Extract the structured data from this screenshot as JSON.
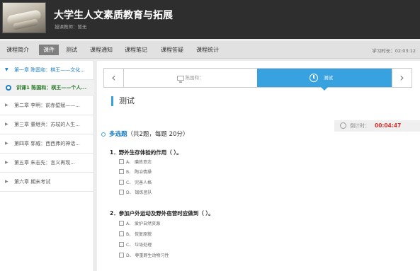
{
  "header": {
    "course_title": "大学生人文素质教育与拓展",
    "teacher_label": "授课教师：暂无"
  },
  "nav": {
    "items": [
      "课程简介",
      "课件",
      "测试",
      "课程通知",
      "课程笔记",
      "课程答疑",
      "课程统计"
    ],
    "active": "课件",
    "study_time": "学习时长：02:03:12"
  },
  "sidebar": {
    "open_chapter": "第一章 陈国和：棋王——文化...",
    "current_lesson": "讲课1 陈国和：棋王——个人...",
    "chapters": [
      "第二章 李明：前赤壁赋——...",
      "第三章 董继兵：苏轼的人生...",
      "第四章 郭威：西西弗的神话...",
      "第五章 朱志先：言义再现...",
      "第六章 期末考试"
    ]
  },
  "tabs": {
    "video_label": "陈国和：",
    "test_label": "测试"
  },
  "section_title": "测试",
  "timer": {
    "label": "倒计时：",
    "value": "00:04:47"
  },
  "quiz": {
    "type_name": "多选题",
    "type_info": "（共2题，每题 20分）",
    "questions": [
      {
        "text": "1．野外生存体验的作用（ ）。",
        "options": [
          "A、 磨炼意志",
          "B、 陶冶情操",
          "C、 完善人格",
          "D、 锻炼团队"
        ]
      },
      {
        "text": "2．参加户外运动及野外宿营时应做到（ ）。",
        "options": [
          "A、 爱护自然资源",
          "B、 恢复原貌",
          "C、 垃圾处理",
          "D、 尊重野生动物习性"
        ]
      }
    ]
  },
  "colors": {
    "accent": "#38a2e0",
    "timer_value": "#d0332f",
    "lesson_text": "#2a7a2a"
  }
}
